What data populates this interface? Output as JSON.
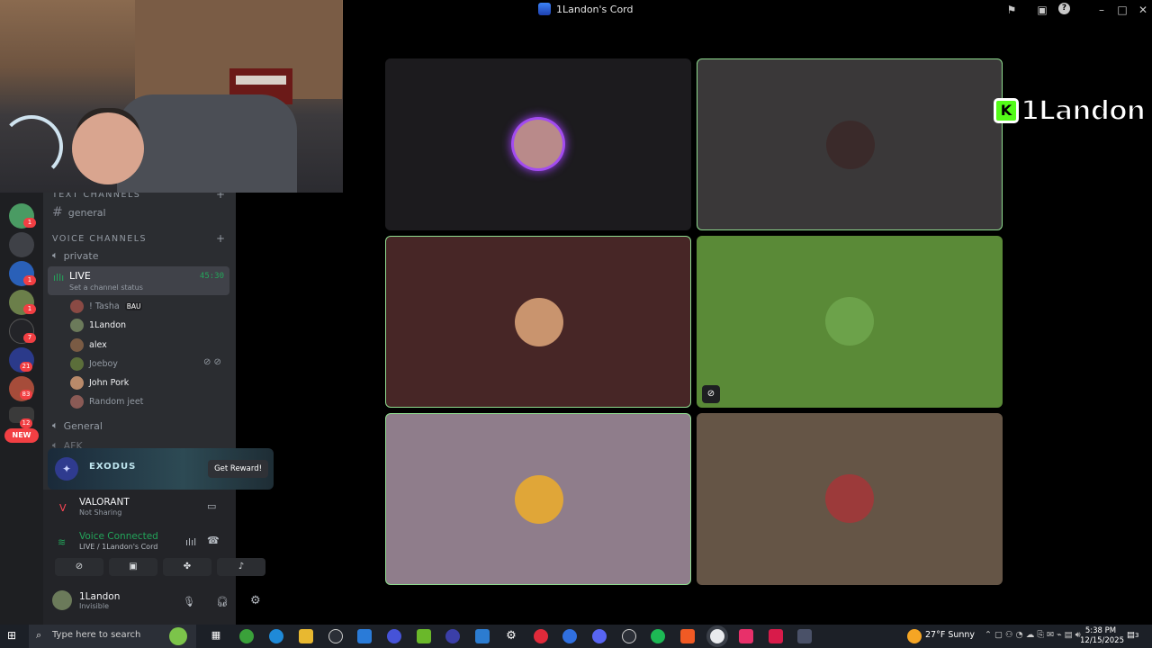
{
  "window": {
    "title": "1Landon's Cord",
    "controls": [
      "flag-icon",
      "inbox-icon",
      "help-icon",
      "minimize-icon",
      "maximize-icon",
      "close-icon"
    ]
  },
  "rail": {
    "servers": [
      {
        "badge": "1",
        "color": "#4a9b63"
      },
      {
        "badge": "",
        "color": "#3f4147"
      },
      {
        "badge": "1",
        "color": "#2a60b8"
      },
      {
        "badge": "1",
        "color": "#6b7f4a"
      },
      {
        "badge": "7",
        "color": "#232428"
      },
      {
        "badge": "21",
        "color": "#2b3a8a"
      },
      {
        "badge": "83",
        "color": "#a64c3a"
      },
      {
        "badge": "12",
        "color": "#3a3a3a"
      }
    ],
    "new_label": "NEW"
  },
  "sidebar": {
    "text_category": "TEXT CHANNELS",
    "text_channels": [
      "general"
    ],
    "voice_category": "VOICE CHANNELS",
    "voice_channels": {
      "private": "private",
      "live": {
        "name": "LIVE",
        "time": "45:30",
        "status": "Set a channel status"
      },
      "general": "General",
      "afk": "AFK"
    },
    "members": [
      {
        "name": "! Tasha",
        "tag": "BAU",
        "dim": true,
        "color": "#8a4a44"
      },
      {
        "name": "1Landon",
        "dim": false,
        "color": "#6b7a5a"
      },
      {
        "name": "alex",
        "dim": false,
        "color": "#7a5b44"
      },
      {
        "name": "Joeboy",
        "dim": true,
        "color": "#5b6e3a"
      },
      {
        "name": "John Pork",
        "dim": false,
        "color": "#b98a6a"
      },
      {
        "name": "Random jeet",
        "dim": true,
        "color": "#8a5a55"
      }
    ]
  },
  "promo": {
    "brand": "EXODUS",
    "button": "Get Reward!"
  },
  "panel": {
    "game": "VALORANT",
    "game_status": "Not Sharing",
    "voice_status": "Voice Connected",
    "voice_location": "LIVE / 1Landon's Cord",
    "user": "1Landon",
    "user_status": "Invisible"
  },
  "tiles": [
    {
      "bg": "#1c1b1e",
      "speaking": false,
      "avatar": "#b98a8a",
      "ring": true
    },
    {
      "bg": "#3a3839",
      "speaking": true,
      "avatar": "#3a2a2a"
    },
    {
      "bg": "#472626",
      "speaking": true,
      "avatar": "#c9946e"
    },
    {
      "bg": "#5a8a37",
      "speaking": false,
      "avatar": "#6ca24a",
      "muted": true
    },
    {
      "bg": "#8f7d8b",
      "speaking": true,
      "avatar": "#e0a638"
    },
    {
      "bg": "#655546",
      "speaking": false,
      "avatar": "#9c3a3a"
    }
  ],
  "overlay": {
    "k": "K",
    "name": "1Landon"
  },
  "taskbar": {
    "search_placeholder": "Type here to search",
    "weather": "27°F  Sunny",
    "time": "5:38 PM",
    "date": "12/15/2025",
    "notification_count": "3"
  }
}
